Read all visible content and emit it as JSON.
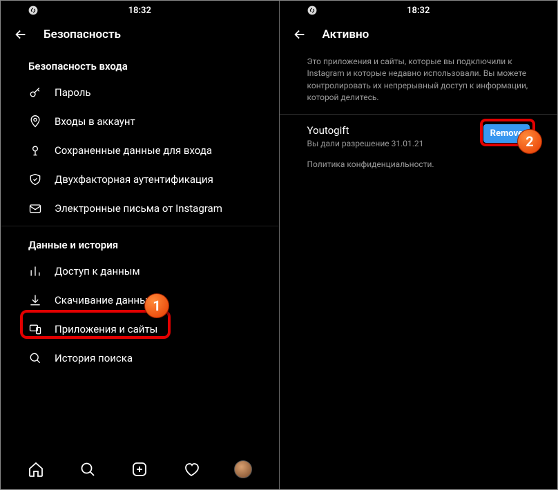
{
  "status": {
    "time": "18:32"
  },
  "left": {
    "title": "Безопасность",
    "section1": "Безопасность входа",
    "items1": {
      "password": "Пароль",
      "login_activity": "Входы в аккаунт",
      "saved_login": "Сохраненные данные для входа",
      "two_factor": "Двухфакторная аутентификация",
      "emails": "Электронные письма от Instagram"
    },
    "section2": "Данные и история",
    "items2": {
      "data_access": "Доступ к данным",
      "download": "Скачивание данных",
      "apps_sites": "Приложения и сайты",
      "search_history": "История поиска"
    }
  },
  "right": {
    "title": "Активно",
    "description": "Это приложения и сайты, которые вы подключили к Instagram и которые недавно использовали. Вы можете контролировать их непрерывный доступ к информации, которой делитесь.",
    "app": {
      "name": "Youtogift",
      "sub": "Вы дали разрешение 31.01.21",
      "remove": "Remove"
    },
    "policy": "Политика конфиденциальности."
  },
  "badges": {
    "one": "1",
    "two": "2"
  }
}
